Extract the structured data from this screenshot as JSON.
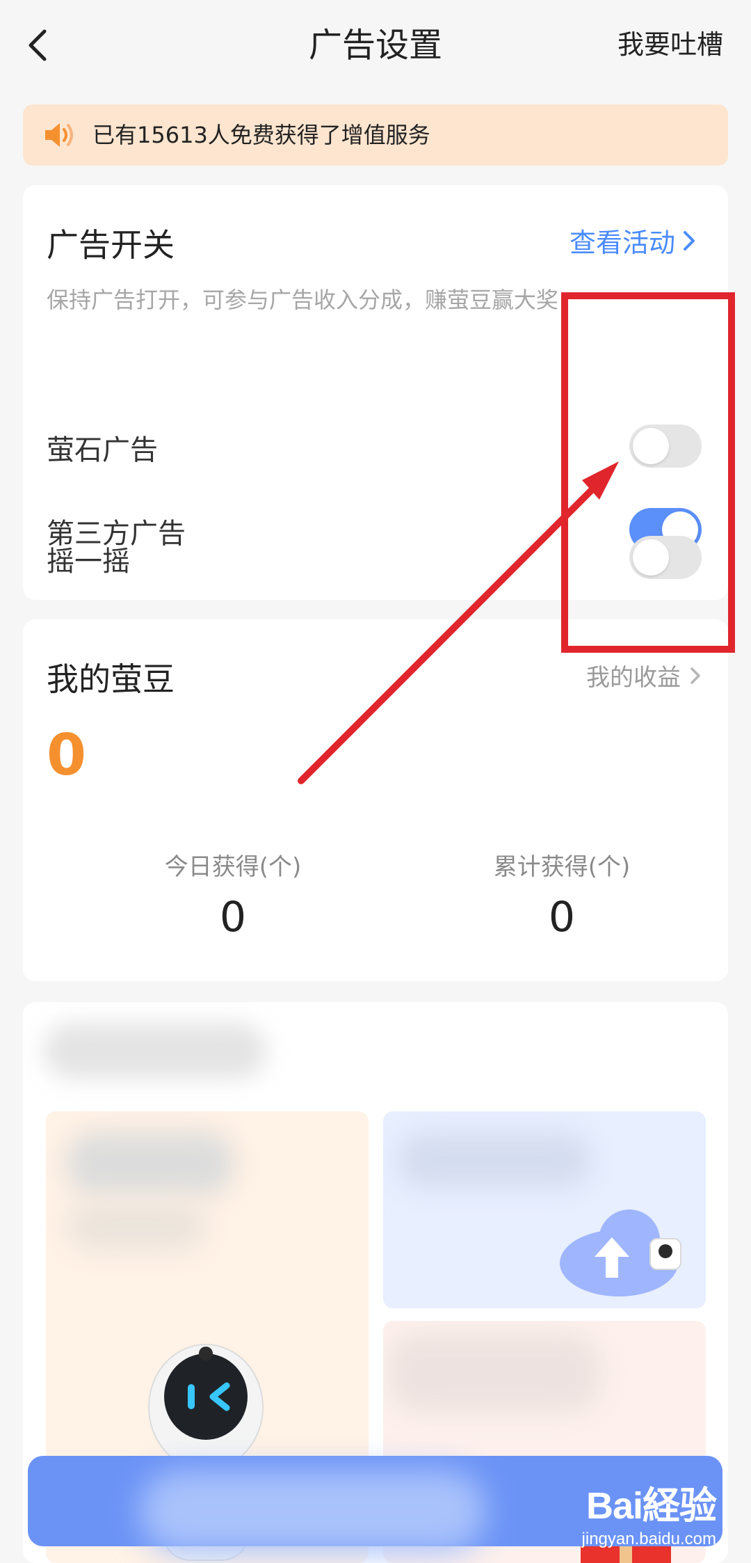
{
  "header": {
    "title": "广告设置",
    "feedback_label": "我要吐槽"
  },
  "notice": {
    "text": "已有15613人免费获得了增值服务"
  },
  "ad_switch": {
    "title": "广告开关",
    "activity_link": "查看活动",
    "subtitle": "保持广告打开，可参与广告收入分成，赚萤豆赢大奖",
    "items": [
      {
        "label": "萤石广告",
        "enabled": false
      },
      {
        "label": "第三方广告",
        "enabled": true
      },
      {
        "label": "摇一摇",
        "enabled": false
      }
    ]
  },
  "beans": {
    "title": "我的萤豆",
    "earnings_link": "我的收益",
    "total": "0",
    "today_label": "今日获得(个)",
    "today_value": "0",
    "cumulative_label": "累计获得(个)",
    "cumulative_value": "0"
  },
  "watermark": {
    "logo": "Bai経验",
    "url": "jingyan.baidu.com"
  },
  "colors": {
    "accent_blue": "#5b8ff9",
    "link_blue": "#4a8bff",
    "bean_orange": "#f5902f",
    "notice_bg": "#fde5cf",
    "annotation_red": "#e0262c"
  }
}
